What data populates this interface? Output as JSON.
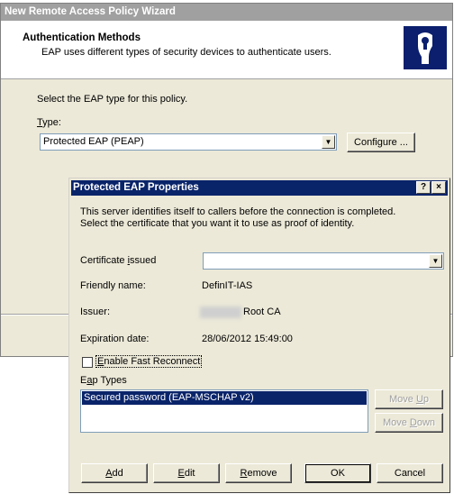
{
  "wizard": {
    "title": "New Remote Access Policy Wizard",
    "header_title": "Authentication Methods",
    "header_desc": "EAP uses different types of security devices to authenticate users.",
    "select_label": "Select the EAP type for this policy.",
    "type_label_u": "T",
    "type_label_rest": "ype:",
    "type_value": "Protected EAP (PEAP)",
    "configure_label": "Configure ..."
  },
  "dialog": {
    "title": "Protected EAP Properties",
    "help_btn": "?",
    "close_btn": "×",
    "desc_line1": "This server identifies itself to callers before the connection is completed.",
    "desc_line2": "Select the certificate that you want it to use as proof of identity.",
    "cert_label_pre": "Certificate ",
    "cert_label_u": "i",
    "cert_label_post": "ssued",
    "cert_value": "",
    "friendly_label": "Friendly name:",
    "friendly_value": "DefinIT-IAS",
    "issuer_label": "Issuer:",
    "issuer_value": "Root CA",
    "expiration_label": "Expiration date:",
    "expiration_value": "28/06/2012 15:49:00",
    "fast_reconnect_u": "E",
    "fast_reconnect_rest": "nable Fast Reconnect",
    "eap_types_pre": "E",
    "eap_types_u": "a",
    "eap_types_post": "p Types",
    "eap_items": [
      "Secured password (EAP-MSCHAP v2)"
    ],
    "move_up_pre": "Move ",
    "move_up_u": "U",
    "move_up_post": "p",
    "move_down_pre": "Move ",
    "move_down_u": "D",
    "move_down_post": "own",
    "add_u": "A",
    "add_rest": "dd",
    "edit_u": "E",
    "edit_rest": "dit",
    "remove_u": "R",
    "remove_rest": "emove",
    "ok_label": "OK",
    "cancel_label": "Cancel"
  },
  "colors": {
    "window_bg": "#ece9d8",
    "titlebar_active": "#0a246a",
    "titlebar_inactive": "#a0a0a0",
    "selection": "#0a246a"
  },
  "icons": {
    "header_icon": "security-hand-icon",
    "dropdown": "chevron-down-icon"
  }
}
